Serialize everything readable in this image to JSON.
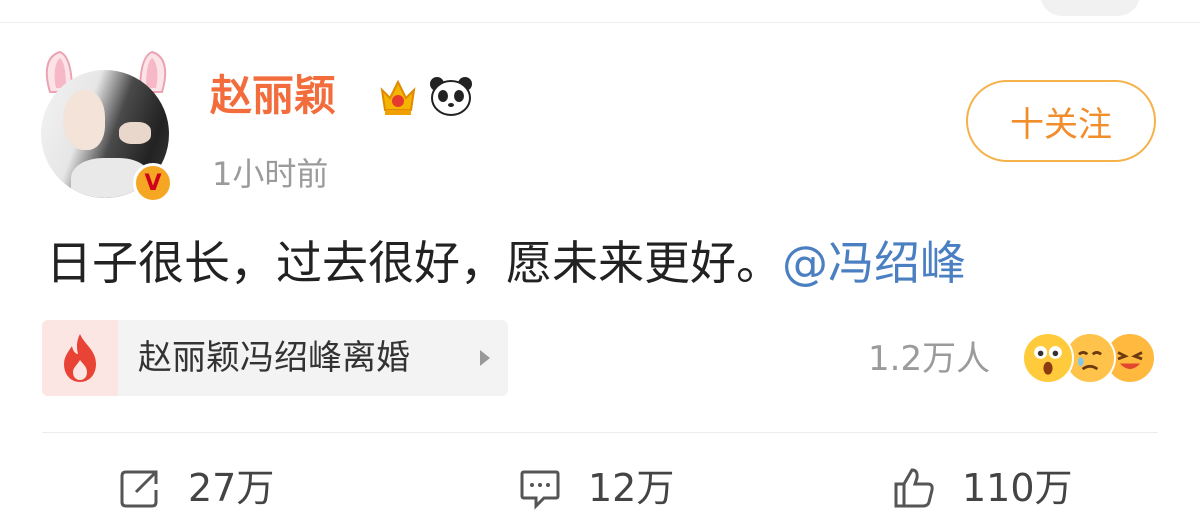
{
  "user": {
    "name": "赵丽颖",
    "time": "1小时前",
    "follow_label": "十关注"
  },
  "post": {
    "text": "日子很长，过去很好，愿未来更好。",
    "mention": "@冯绍峰"
  },
  "topic": {
    "label": "赵丽颖冯绍峰离婚",
    "icon": "fire-icon"
  },
  "reactions": {
    "count": "1.2万人",
    "emojis": [
      "wow-emoji",
      "sad-emoji",
      "laugh-emoji"
    ]
  },
  "actions": {
    "repost": "27万",
    "comment": "12万",
    "like": "110万"
  },
  "colors": {
    "username": "#f26c3c",
    "follow": "#f28d2c",
    "mention": "#4a7fc1",
    "fire": "#e94336"
  }
}
